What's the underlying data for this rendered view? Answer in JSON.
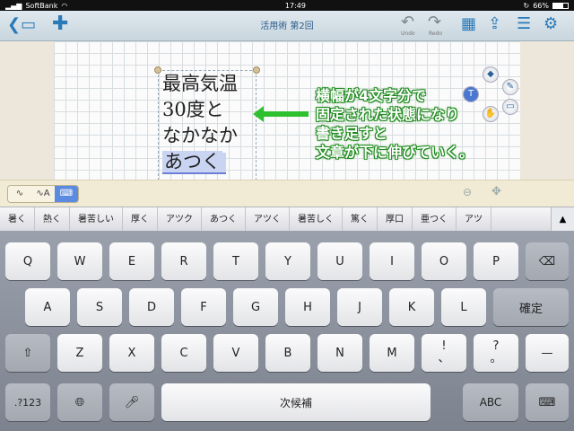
{
  "status": {
    "carrier": "SoftBank",
    "time": "17:49",
    "battery": "66%",
    "battery_level": 0.66
  },
  "toolbar": {
    "title": "活用術 第2回",
    "back_icon": "back-folder-icon",
    "add_icon": "plus-icon",
    "undo_label": "Undo",
    "redo_label": "Redo",
    "icons": [
      "layout-icon",
      "share-icon",
      "list-icon",
      "settings-icon"
    ]
  },
  "note": {
    "lines": [
      "最高気温",
      "30度と",
      "なかなか"
    ],
    "active_line": "あつく"
  },
  "callout": {
    "lines": [
      "横幅が4文字分で",
      "固定された状態になり",
      "書き足すと",
      "文章が下に伸びていく。"
    ],
    "color": "#2fc02f"
  },
  "radial_menu": {
    "items": [
      "diamond-icon",
      "pen-icon",
      "text-icon",
      "hand-icon",
      "eraser-icon"
    ]
  },
  "mode_bar": {
    "modes": [
      "pen",
      "pen-text",
      "keyboard"
    ],
    "selected": "keyboard"
  },
  "candidates": [
    "暑く",
    "熱く",
    "暑苦しい",
    "厚く",
    "アツク",
    "あつく",
    "アツく",
    "暑苦しく",
    "篤く",
    "厚口",
    "亜つく",
    "アツ"
  ],
  "candidates_more": "▲",
  "keyboard": {
    "row1": [
      "Q",
      "W",
      "E",
      "R",
      "T",
      "Y",
      "U",
      "I",
      "O",
      "P"
    ],
    "row2": [
      "A",
      "S",
      "D",
      "F",
      "G",
      "H",
      "J",
      "K",
      "L"
    ],
    "row3": [
      "Z",
      "X",
      "C",
      "V",
      "B",
      "N",
      "M"
    ],
    "punct1_top": "!",
    "punct1_bottom": "、",
    "punct2_top": "?",
    "punct2_bottom": "。",
    "dash": "—",
    "confirm": "確定",
    "numbers": ".?123",
    "space": "次候補",
    "abc": "ABC"
  }
}
